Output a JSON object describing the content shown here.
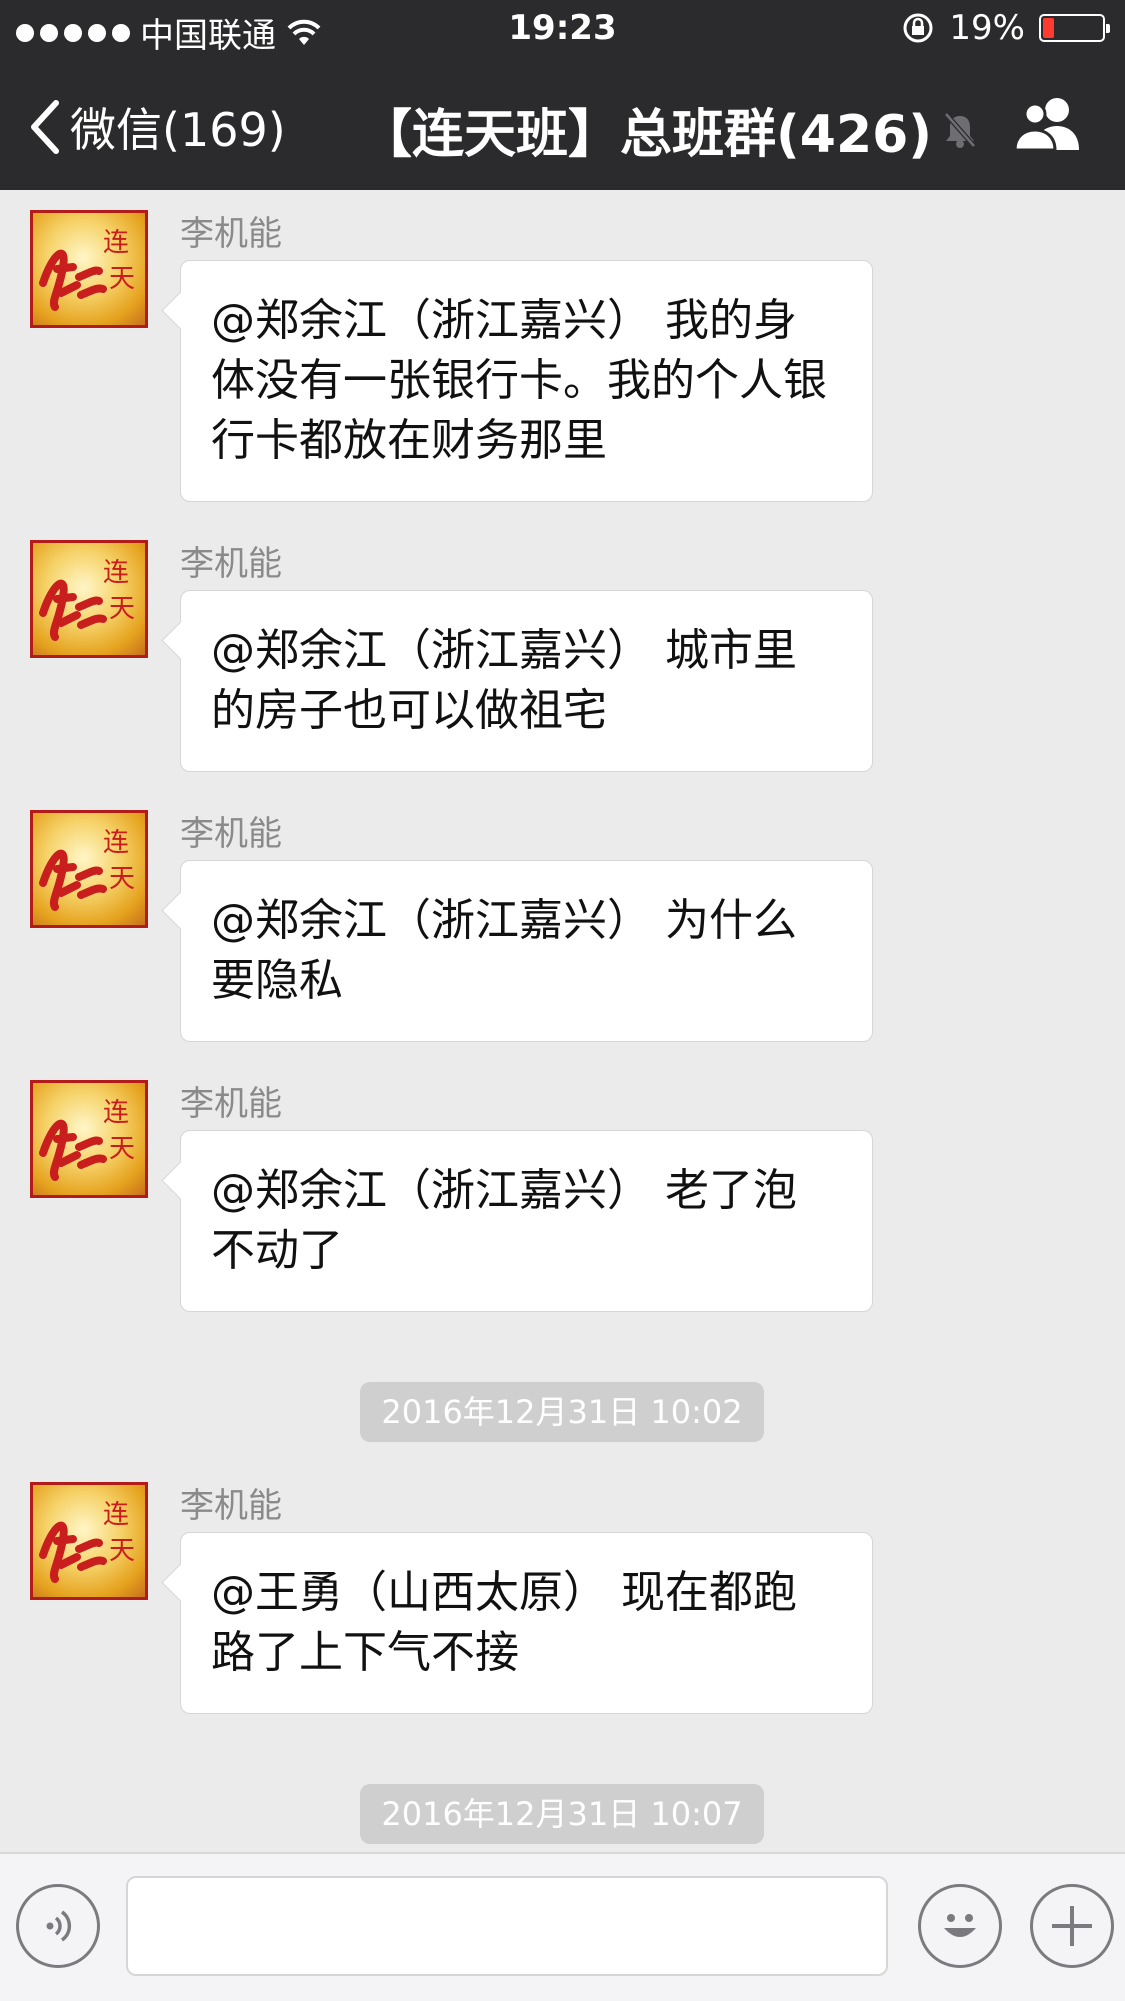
{
  "status_bar": {
    "carrier": "中国联通",
    "time": "19:23",
    "battery_text": "19%",
    "battery_level": 0.19
  },
  "nav": {
    "back_label": "微信(169)",
    "title": "【连天班】总班群(426)"
  },
  "messages": [
    {
      "sender": "李机能",
      "text": "@郑余江（浙江嘉兴） 我的身体没有一张银行卡。我的个人银行卡都放在财务那里"
    },
    {
      "sender": "李机能",
      "text": "@郑余江（浙江嘉兴） 城市里的房子也可以做祖宅"
    },
    {
      "sender": "李机能",
      "text": "@郑余江（浙江嘉兴） 为什么要隐私"
    },
    {
      "sender": "李机能",
      "text": "@郑余江（浙江嘉兴） 老了泡不动了"
    },
    {
      "sender": "李机能",
      "text": "@王勇（山西太原） 现在都跑路了上下气不接"
    }
  ],
  "timestamps": [
    "2016年12月31日 10:02",
    "2016年12月31日 10:07"
  ],
  "avatar_text": "红 连天",
  "colors": {
    "nav_bg": "#2b2b2d",
    "chat_bg": "#ebebeb",
    "bubble_bg": "#ffffff",
    "avatar_red": "#b31b1b",
    "battery_red": "#ff3b30"
  },
  "icons": {
    "back": "chevron-left-icon",
    "mute": "bell-slash-icon",
    "people": "group-people-icon",
    "voice": "voice-icon",
    "emoji": "smile-icon",
    "plus": "plus-icon",
    "wifi": "wifi-icon",
    "rotation_lock": "rotation-lock-icon"
  }
}
